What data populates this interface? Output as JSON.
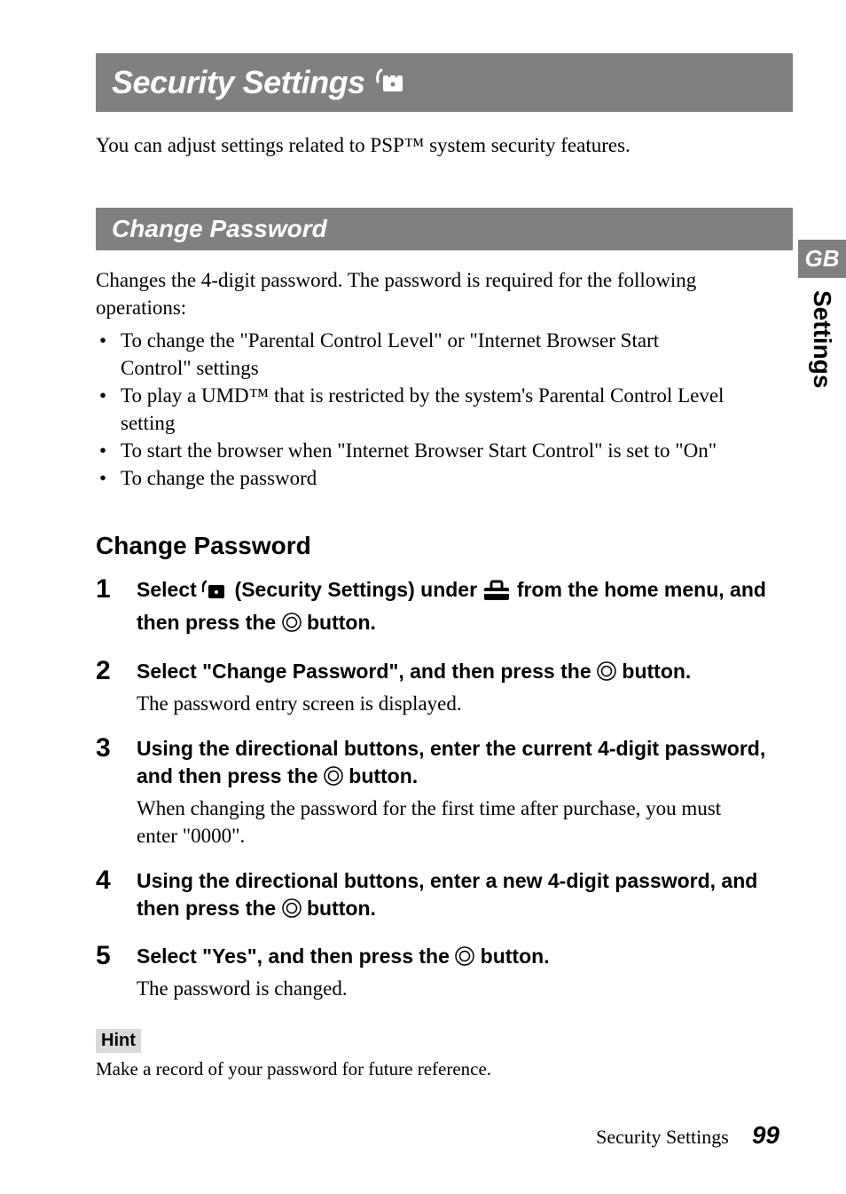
{
  "title": "Security Settings",
  "intro": "You can adjust settings related to PSP™ system security features.",
  "section1": {
    "heading": "Change Password",
    "intro": "Changes the 4-digit password. The password is required for the following operations:",
    "bullets": [
      "To change the \"Parental Control Level\" or \"Internet Browser Start Control\" settings",
      "To play a UMD™ that is restricted by the system's Parental Control Level setting",
      "To start the browser when \"Internet Browser Start Control\" is set to \"On\"",
      "To change the password"
    ]
  },
  "subsection_title": "Change Password",
  "steps": [
    {
      "num": "1",
      "head_pre": "Select ",
      "head_mid1": " (Security Settings) under ",
      "head_mid2": " from the home menu, and then press the ",
      "head_post": " button.",
      "desc": ""
    },
    {
      "num": "2",
      "head_pre": "Select \"Change Password\", and then press the ",
      "head_post": " button.",
      "desc": "The password entry screen is displayed."
    },
    {
      "num": "3",
      "head_pre": "Using the directional buttons, enter the current 4-digit password, and then press the ",
      "head_post": " button.",
      "desc": "When changing the password for the first time after purchase, you must enter \"0000\"."
    },
    {
      "num": "4",
      "head_pre": "Using the directional buttons, enter a new 4-digit password, and then press the ",
      "head_post": " button.",
      "desc": ""
    },
    {
      "num": "5",
      "head_pre": "Select \"Yes\", and then press the ",
      "head_post": " button.",
      "desc": "The password is changed."
    }
  ],
  "hint_label": "Hint",
  "hint_text": "Make a record of your password for future reference.",
  "side": {
    "gb": "GB",
    "settings": "Settings"
  },
  "footer": {
    "label": "Security Settings",
    "page": "99"
  }
}
